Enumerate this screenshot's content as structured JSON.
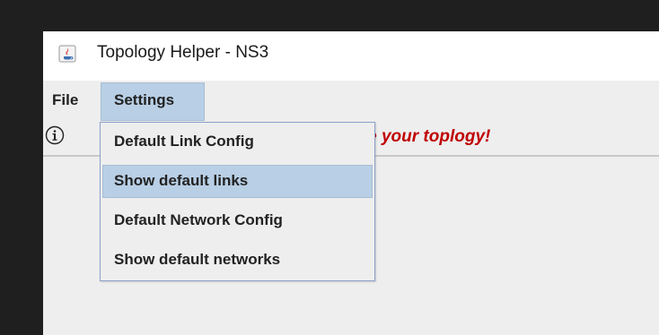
{
  "window": {
    "title": "Topology Helper - NS3",
    "icon": "java-app-icon"
  },
  "menubar": {
    "items": [
      {
        "label": "File"
      },
      {
        "label": "Settings",
        "active": true
      }
    ]
  },
  "toolbar": {
    "icon": "info-icon",
    "hint_visible": "ake your toplogy!"
  },
  "settings_menu": {
    "items": [
      {
        "label": "Default Link Config"
      },
      {
        "label": "Show default links",
        "highlighted": true
      },
      {
        "label": "Default Network Config"
      },
      {
        "label": "Show default networks"
      }
    ]
  },
  "colors": {
    "menu_highlight": "#b8cfe5",
    "hint_text": "#c00000",
    "window_bg": "#eeeeee",
    "desktop_bg": "#1f1f1f"
  }
}
